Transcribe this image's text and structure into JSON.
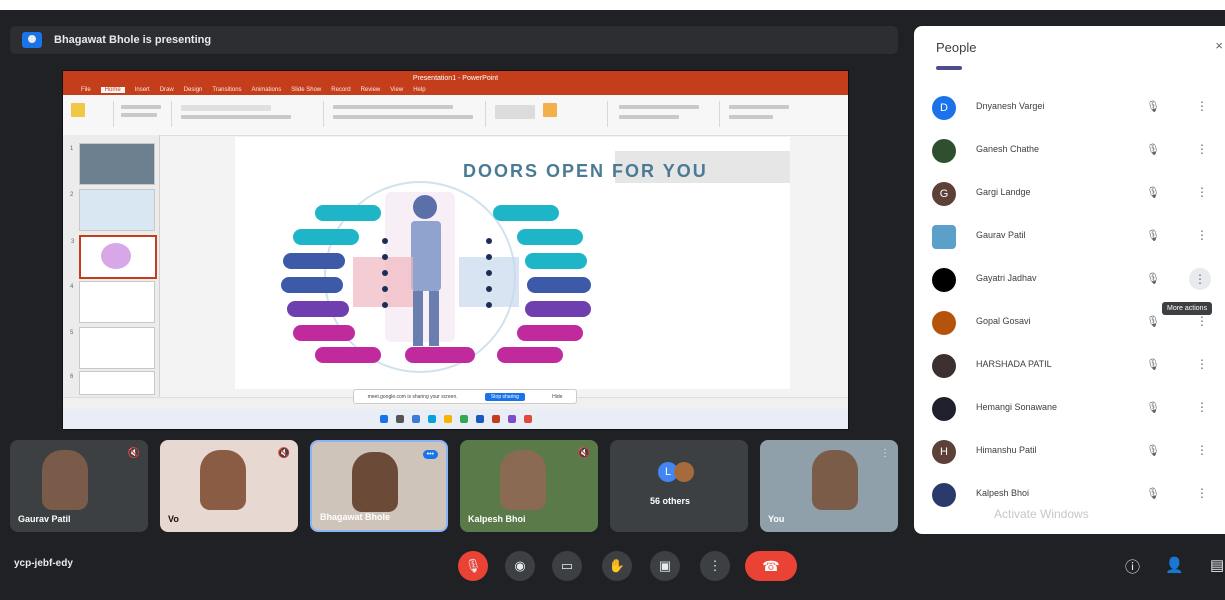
{
  "presenting": {
    "text": "Bhagawat Bhole is presenting"
  },
  "presentation": {
    "window_title": "Presentation1 - PowerPoint",
    "ribbon_tabs": [
      "File",
      "Home",
      "Insert",
      "Draw",
      "Design",
      "Transitions",
      "Animations",
      "Slide Show",
      "Record",
      "Review",
      "View",
      "Help"
    ],
    "active_tab": "Home",
    "slide_title": "DOORS OPEN FOR YOU",
    "thumb_numbers": [
      "1",
      "2",
      "3",
      "4",
      "5",
      "6"
    ],
    "share_tip": {
      "text": "meet.google.com is sharing your screen.",
      "stop": "Stop sharing",
      "hide": "Hide"
    }
  },
  "tiles": [
    {
      "name": "Gaurav Patil"
    },
    {
      "name": "Vo"
    },
    {
      "name": "Bhagawat Bhole"
    },
    {
      "name": "Kalpesh Bhoi"
    },
    {
      "name": "56 others"
    },
    {
      "name": "You"
    }
  ],
  "people_panel": {
    "title": "People",
    "close": "×",
    "participants": [
      {
        "name": "Dnyanesh Vargei",
        "initial": "D",
        "color": "#1a73e8"
      },
      {
        "name": "Ganesh Chathe",
        "initial": "",
        "color": "#2f4f2f"
      },
      {
        "name": "Gargi Landge",
        "initial": "G",
        "color": "#5d4037"
      },
      {
        "name": "Gaurav Patil",
        "initial": "",
        "color": "#5aa0c8"
      },
      {
        "name": "Gayatri Jadhav",
        "initial": "",
        "color": "#000000"
      },
      {
        "name": "Gopal Gosavi",
        "initial": "",
        "color": "#b45309"
      },
      {
        "name": "HARSHADA PATIL",
        "initial": "",
        "color": "#3b2f2f"
      },
      {
        "name": "Hemangi Sonawane",
        "initial": "",
        "color": "#1f1f2e"
      },
      {
        "name": "Himanshu Patil",
        "initial": "H",
        "color": "#5d4037"
      },
      {
        "name": "Kalpesh Bhoi",
        "initial": "",
        "color": "#2a3b6b"
      }
    ],
    "tooltip": "More actions",
    "watermark": "Activate Windows"
  },
  "controls": {
    "meeting_code": "ycp-jebf-edy",
    "buttons": [
      "mic-off-icon",
      "camera-icon",
      "captions-icon",
      "raise-hand-icon",
      "present-icon",
      "more-vert-icon"
    ],
    "end_call": "end-call-icon"
  },
  "colors": {
    "background": "#202124",
    "accent": "#1a73e8",
    "danger": "#ea4335",
    "ppt": "#c43e1c"
  }
}
